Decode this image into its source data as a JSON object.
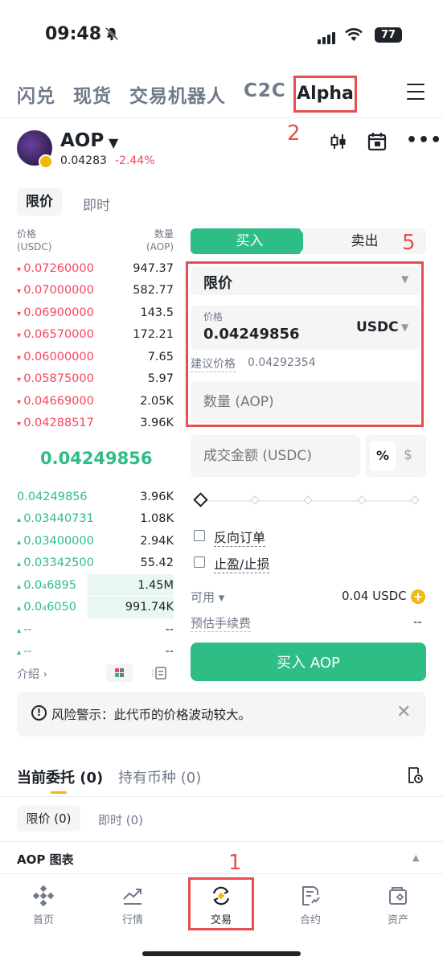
{
  "status_bar": {
    "time": "09:48",
    "battery": "77"
  },
  "top_nav": {
    "tabs": [
      "闪兑",
      "现货",
      "交易机器人",
      "C2C"
    ],
    "active_tab": "Alpha"
  },
  "annotations": {
    "a1": "1",
    "a2": "2",
    "a5": "5"
  },
  "pair": {
    "name": "AOP",
    "price": "0.04283",
    "change": "-2.44%"
  },
  "orderbook": {
    "tabs": {
      "limit": "限价",
      "instant": "即时"
    },
    "headers": {
      "price": "价格",
      "price_unit": "(USDC)",
      "qty": "数量",
      "qty_unit": "(AOP)"
    },
    "asks": [
      {
        "price": "0.07260000",
        "qty": "947.37"
      },
      {
        "price": "0.07000000",
        "qty": "582.77"
      },
      {
        "price": "0.06900000",
        "qty": "143.5"
      },
      {
        "price": "0.06570000",
        "qty": "172.21"
      },
      {
        "price": "0.06000000",
        "qty": "7.65"
      },
      {
        "price": "0.05875000",
        "qty": "5.97"
      },
      {
        "price": "0.04669000",
        "qty": "2.05K"
      },
      {
        "price": "0.04288517",
        "qty": "3.96K"
      }
    ],
    "mid_price": "0.04249856",
    "bids": [
      {
        "price": "0.04249856",
        "qty": "3.96K",
        "depth": 0
      },
      {
        "price": "0.03440731",
        "qty": "1.08K",
        "depth": 0
      },
      {
        "price": "0.03400000",
        "qty": "2.94K",
        "depth": 0
      },
      {
        "price": "0.03342500",
        "qty": "55.42",
        "depth": 0
      },
      {
        "price": "0.0₄6895",
        "qty": "1.45M",
        "depth": 0.55
      },
      {
        "price": "0.0₄6050",
        "qty": "991.74K",
        "depth": 0.55
      },
      {
        "price": "--",
        "qty": "--",
        "depth": 0
      },
      {
        "price": "--",
        "qty": "--",
        "depth": 0
      }
    ],
    "intro": "介绍 ›"
  },
  "trade_form": {
    "buy": "买入",
    "sell": "卖出",
    "order_type": "限价",
    "price_label": "价格",
    "price_value": "0.04249856",
    "price_unit": "USDC",
    "suggest_label": "建议价格",
    "suggest_value": "0.04292354",
    "qty_placeholder": "数量 (AOP)",
    "total_placeholder": "成交金额 (USDC)",
    "unit_pct": "%",
    "unit_usd": "$",
    "reverse_order": "反向订单",
    "tp_sl": "止盈/止损",
    "avail_label": "可用 ▾",
    "avail_value": "0.04 USDC",
    "fee_label": "预估手续费",
    "fee_value": "--",
    "submit": "买入 AOP"
  },
  "risk": {
    "text": "风险警示：此代币的价格波动较大。"
  },
  "orders": {
    "tab_orders": "当前委托 (0)",
    "tab_holdings": "持有币种 (0)",
    "sub_limit": "限价 (0)",
    "sub_instant": "即时 (0)",
    "chart_label": "AOP 图表"
  },
  "bottom_nav": [
    "首页",
    "行情",
    "交易",
    "合约",
    "资产"
  ],
  "colors": {
    "green": "#2ebd85",
    "red": "#f6465d",
    "yellow": "#f0b90b",
    "annotation": "#e84e4e"
  }
}
